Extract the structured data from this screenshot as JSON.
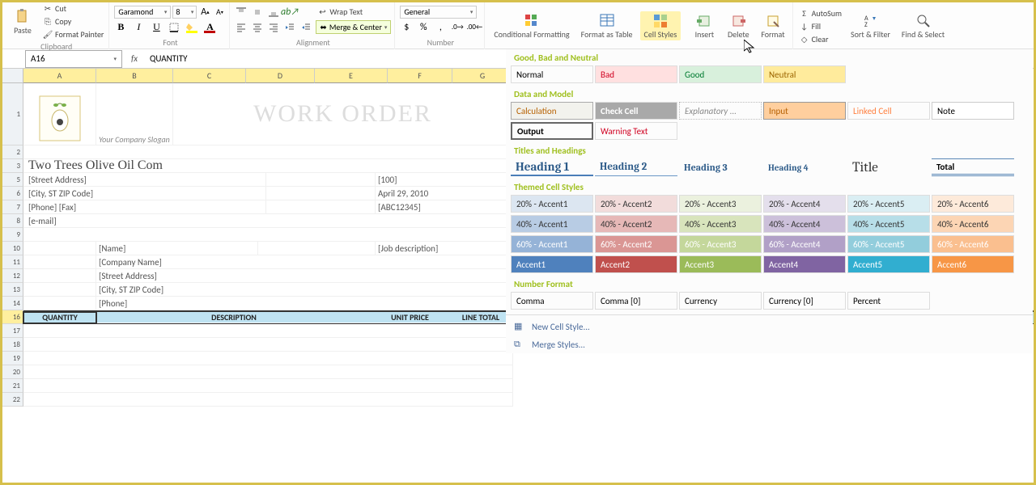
{
  "ribbon": {
    "clipboard": {
      "label": "Clipboard",
      "paste": "Paste",
      "cut": "Cut",
      "copy": "Copy",
      "fp": "Format Painter"
    },
    "font": {
      "label": "Font",
      "name": "Garamond",
      "size": "8",
      "bold": "B",
      "italic": "I",
      "under": "U"
    },
    "alignment": {
      "label": "Alignment",
      "wrap": "Wrap Text",
      "merge": "Merge & Center"
    },
    "number": {
      "label": "Number",
      "general": "General"
    },
    "styles": {
      "cond": "Conditional Formatting",
      "fat": "Format as Table",
      "cell": "Cell Styles"
    },
    "cells": {
      "insert": "Insert",
      "delete": "Delete",
      "format": "Format"
    },
    "editing": {
      "autosum": "AutoSum",
      "fill": "Fill",
      "clear": "Clear",
      "sortfilter": "Sort & Filter",
      "findselect": "Find & Select"
    }
  },
  "formulabar": {
    "ref": "A16",
    "formula": "QUANTITY"
  },
  "cols": [
    "A",
    "B",
    "C",
    "D",
    "E",
    "F",
    "G"
  ],
  "rows": [
    "1",
    "2",
    "3",
    "5",
    "6",
    "7",
    "8",
    "9",
    "10",
    "11",
    "12",
    "13",
    "14",
    "16",
    "17",
    "18",
    "19",
    "20",
    "21",
    "22"
  ],
  "sheet": {
    "slogan": "Your Company Slogan",
    "title": "WORK ORDER",
    "company": "Two Trees Olive Oil Com",
    "row5a": "[Street Address]",
    "row5f": "[100]",
    "row6a": "[City, ST  ZIP Code]",
    "row6f": "April 29, 2010",
    "row7a": "[Phone] [Fax]",
    "row7f": "[ABC12345]",
    "row8a": "[e-mail]",
    "row10b": "[Name]",
    "row10f": "[Job description]",
    "row11b": "[Company Name]",
    "row12b": "[Street Address]",
    "row13b": "[City, ST  ZIP Code]",
    "row14b": "[Phone]",
    "th_qty": "QUANTITY",
    "th_desc": "DESCRIPTION",
    "th_up": "UNIT PRICE",
    "th_lt": "LINE TOTAL"
  },
  "styles": {
    "g1": "Good, Bad and Neutral",
    "normal": "Normal",
    "bad": "Bad",
    "good": "Good",
    "neutral": "Neutral",
    "g2": "Data and Model",
    "calc": "Calculation",
    "check": "Check Cell",
    "expl": "Explanatory ...",
    "input": "Input",
    "linked": "Linked Cell",
    "note": "Note",
    "output": "Output",
    "warn": "Warning Text",
    "g3": "Titles and Headings",
    "h1": "Heading 1",
    "h2": "Heading 2",
    "h3": "Heading 3",
    "h4": "Heading 4",
    "title": "Title",
    "total": "Total",
    "g4": "Themed Cell Styles",
    "a20": [
      "20% - Accent1",
      "20% - Accent2",
      "20% - Accent3",
      "20% - Accent4",
      "20% - Accent5",
      "20% - Accent6"
    ],
    "a40": [
      "40% - Accent1",
      "40% - Accent2",
      "40% - Accent3",
      "40% - Accent4",
      "40% - Accent5",
      "40% - Accent6"
    ],
    "a60": [
      "60% - Accent1",
      "60% - Accent2",
      "60% - Accent3",
      "60% - Accent4",
      "60% - Accent5",
      "60% - Accent6"
    ],
    "af": [
      "Accent1",
      "Accent2",
      "Accent3",
      "Accent4",
      "Accent5",
      "Accent6"
    ],
    "g5": "Number Format",
    "nf": [
      "Comma",
      "Comma [0]",
      "Currency",
      "Currency [0]",
      "Percent"
    ],
    "new": "New Cell Style...",
    "mergest": "Merge Styles..."
  }
}
